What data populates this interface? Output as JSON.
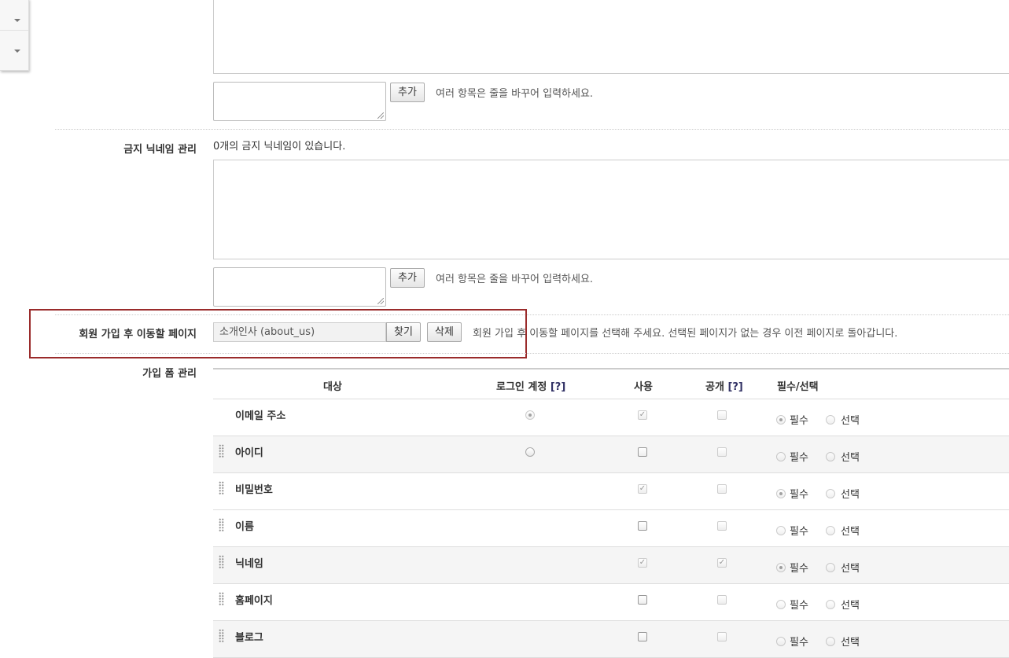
{
  "add_button_label": "추가",
  "multi_line_help": "여러 항목은 줄을 바꾸어 입력하세요.",
  "banned_nickname": {
    "label": "금지 닉네임 관리",
    "count_text": "0개의 금지 닉네임이 있습니다."
  },
  "redirect_page": {
    "label": "회원 가입 후 이동할 페이지",
    "value": "소개인사 (about_us)",
    "find_button": "찾기",
    "delete_button": "삭제",
    "help": "회원 가입 후 이동할 페이지를 선택해 주세요. 선택된 페이지가 없는 경우 이전 페이지로 돌아갑니다."
  },
  "signup_form": {
    "label": "가입 폼 관리",
    "columns": {
      "target": "대상",
      "login_account": "로그인 계정",
      "use": "사용",
      "public": "공개",
      "required_optional": "필수/선택",
      "help_mark": "[?]"
    },
    "required_label": "필수",
    "optional_label": "선택",
    "rows": [
      {
        "name": "이메일 주소",
        "login_account": true,
        "use": true,
        "public": false,
        "required": true
      },
      {
        "name": "아이디",
        "login_account": false,
        "use": false,
        "public": false,
        "required": false
      },
      {
        "name": "비밀번호",
        "login_account": null,
        "use": true,
        "public": false,
        "required": true
      },
      {
        "name": "이름",
        "login_account": null,
        "use": false,
        "public": false,
        "required": false
      },
      {
        "name": "닉네임",
        "login_account": null,
        "use": true,
        "public": true,
        "required": true
      },
      {
        "name": "홈페이지",
        "login_account": null,
        "use": false,
        "public": false,
        "required": false
      },
      {
        "name": "블로그",
        "login_account": null,
        "use": false,
        "public": false,
        "required": false
      }
    ]
  }
}
